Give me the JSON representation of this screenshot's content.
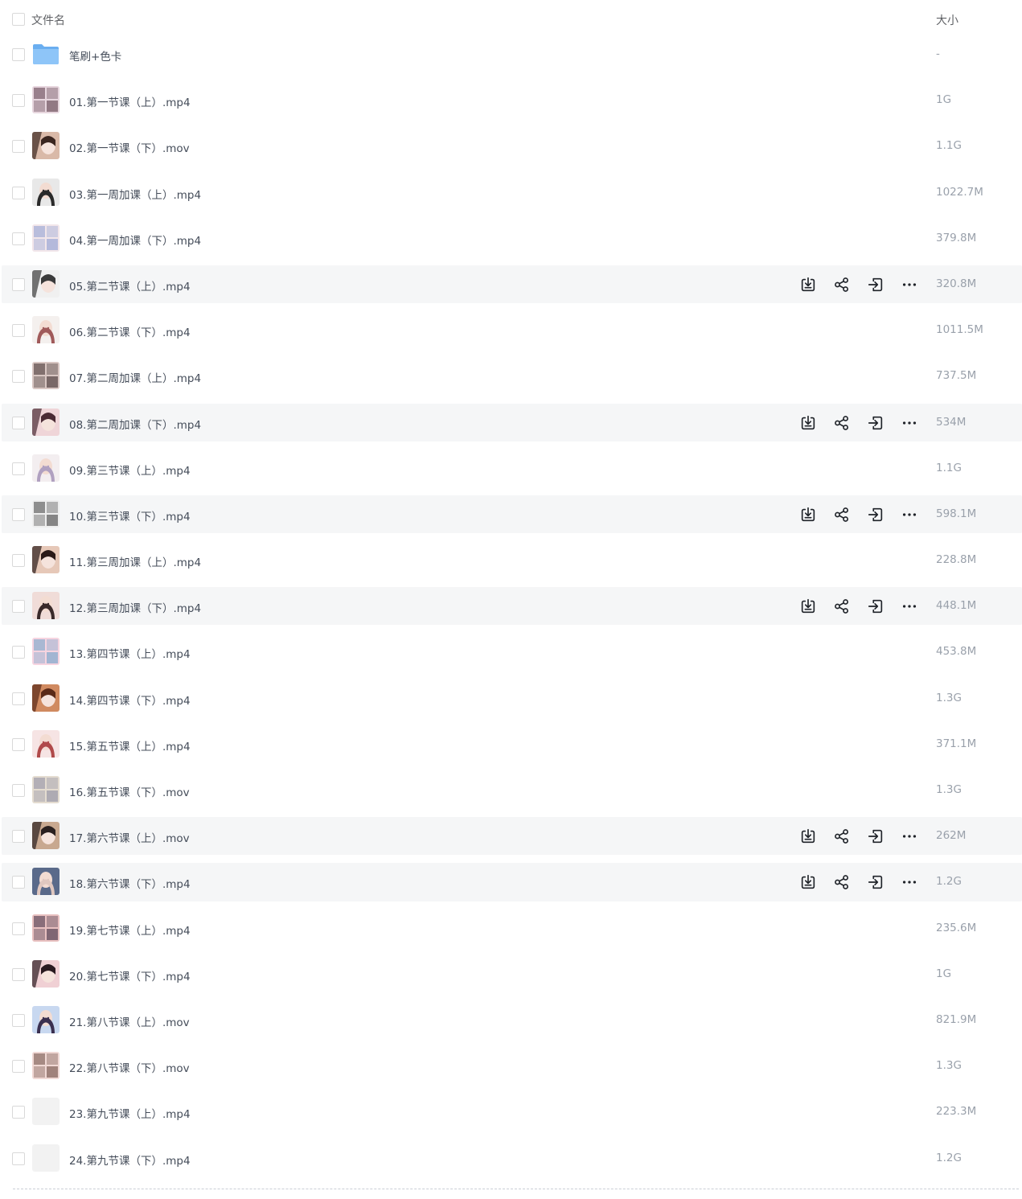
{
  "header": {
    "name_label": "文件名",
    "size_label": "大小"
  },
  "actions": {
    "download": "download-icon",
    "share": "share-icon",
    "move": "move-icon",
    "more": "more-icon"
  },
  "files": [
    {
      "name": "笔刷+色卡",
      "size": "-",
      "type": "folder",
      "hovered": false,
      "colors": [
        "#8ec5f8",
        "#6aaef0"
      ]
    },
    {
      "name": "01.第一节课（上）.mp4",
      "size": "1G",
      "type": "video",
      "hovered": false,
      "colors": [
        "#e7d6de",
        "#5a3a48"
      ]
    },
    {
      "name": "02.第一节课（下）.mov",
      "size": "1.1G",
      "type": "video",
      "hovered": false,
      "colors": [
        "#d9b9a8",
        "#3a2620"
      ]
    },
    {
      "name": "03.第一周加课（上）.mp4",
      "size": "1022.7M",
      "type": "video",
      "hovered": false,
      "colors": [
        "#e8e8e8",
        "#2a2a2a"
      ]
    },
    {
      "name": "04.第一周加课（下）.mp4",
      "size": "379.8M",
      "type": "video",
      "hovered": false,
      "colors": [
        "#f2e6ea",
        "#8a9bd0"
      ]
    },
    {
      "name": "05.第二节课（上）.mp4",
      "size": "320.8M",
      "type": "video",
      "hovered": true,
      "colors": [
        "#f0f0f0",
        "#3a3a3a"
      ]
    },
    {
      "name": "06.第二节课（下）.mp4",
      "size": "1011.5M",
      "type": "video",
      "hovered": false,
      "colors": [
        "#f4f0ee",
        "#a05a5a"
      ]
    },
    {
      "name": "07.第二周加课（上）.mp4",
      "size": "737.5M",
      "type": "video",
      "hovered": false,
      "colors": [
        "#d8c6c2",
        "#3a2a2a"
      ]
    },
    {
      "name": "08.第二周加课（下）.mp4",
      "size": "534M",
      "type": "video",
      "hovered": true,
      "colors": [
        "#efd5d8",
        "#4a2a34"
      ]
    },
    {
      "name": "09.第三节课（上）.mp4",
      "size": "1.1G",
      "type": "video",
      "hovered": false,
      "colors": [
        "#f3eef0",
        "#b0a0c0"
      ]
    },
    {
      "name": "10.第三节课（下）.mp4",
      "size": "598.1M",
      "type": "video",
      "hovered": true,
      "colors": [
        "#eeeeee",
        "#404040"
      ]
    },
    {
      "name": "11.第三周加课（上）.mp4",
      "size": "228.8M",
      "type": "video",
      "hovered": false,
      "colors": [
        "#e6c8b8",
        "#2a1a18"
      ]
    },
    {
      "name": "12.第三周加课（下）.mp4",
      "size": "448.1M",
      "type": "video",
      "hovered": true,
      "colors": [
        "#f0dcd8",
        "#3a2a2a"
      ]
    },
    {
      "name": "13.第四节课（上）.mp4",
      "size": "453.8M",
      "type": "video",
      "hovered": false,
      "colors": [
        "#f6d4e0",
        "#6aa0c8"
      ]
    },
    {
      "name": "14.第四节课（下）.mp4",
      "size": "1.3G",
      "type": "video",
      "hovered": false,
      "colors": [
        "#d08a60",
        "#5a2a18"
      ]
    },
    {
      "name": "15.第五节课（上）.mp4",
      "size": "371.1M",
      "type": "video",
      "hovered": false,
      "colors": [
        "#f6e4e4",
        "#b04a4a"
      ]
    },
    {
      "name": "16.第五节课（下）.mov",
      "size": "1.3G",
      "type": "video",
      "hovered": false,
      "colors": [
        "#e4dcd0",
        "#8a8aa0"
      ]
    },
    {
      "name": "17.第六节课（上）.mov",
      "size": "262M",
      "type": "video",
      "hovered": true,
      "colors": [
        "#c8a890",
        "#2a2020"
      ]
    },
    {
      "name": "18.第六节课（下）.mp4",
      "size": "1.2G",
      "type": "video",
      "hovered": true,
      "colors": [
        "#5a6a8a",
        "#e0c8c0"
      ]
    },
    {
      "name": "19.第七节课（上）.mp4",
      "size": "235.6M",
      "type": "video",
      "hovered": false,
      "colors": [
        "#e8c0c0",
        "#3a2a40"
      ]
    },
    {
      "name": "20.第七节课（下）.mp4",
      "size": "1G",
      "type": "video",
      "hovered": false,
      "colors": [
        "#f0d0d4",
        "#2a1a20"
      ]
    },
    {
      "name": "21.第八节课（上）.mov",
      "size": "821.9M",
      "type": "video",
      "hovered": false,
      "colors": [
        "#c8d8f0",
        "#3a3050"
      ]
    },
    {
      "name": "22.第八节课（下）.mov",
      "size": "1.3G",
      "type": "video",
      "hovered": false,
      "colors": [
        "#f0d8d4",
        "#6a4a40"
      ]
    },
    {
      "name": "23.第九节课（上）.mp4",
      "size": "223.3M",
      "type": "video",
      "hovered": false,
      "colors": [
        "#f2f2f2",
        "#f2f2f2"
      ]
    },
    {
      "name": "24.第九节课（下）.mp4",
      "size": "1.2G",
      "type": "video",
      "hovered": false,
      "colors": [
        "#f2f2f2",
        "#f2f2f2"
      ]
    }
  ]
}
